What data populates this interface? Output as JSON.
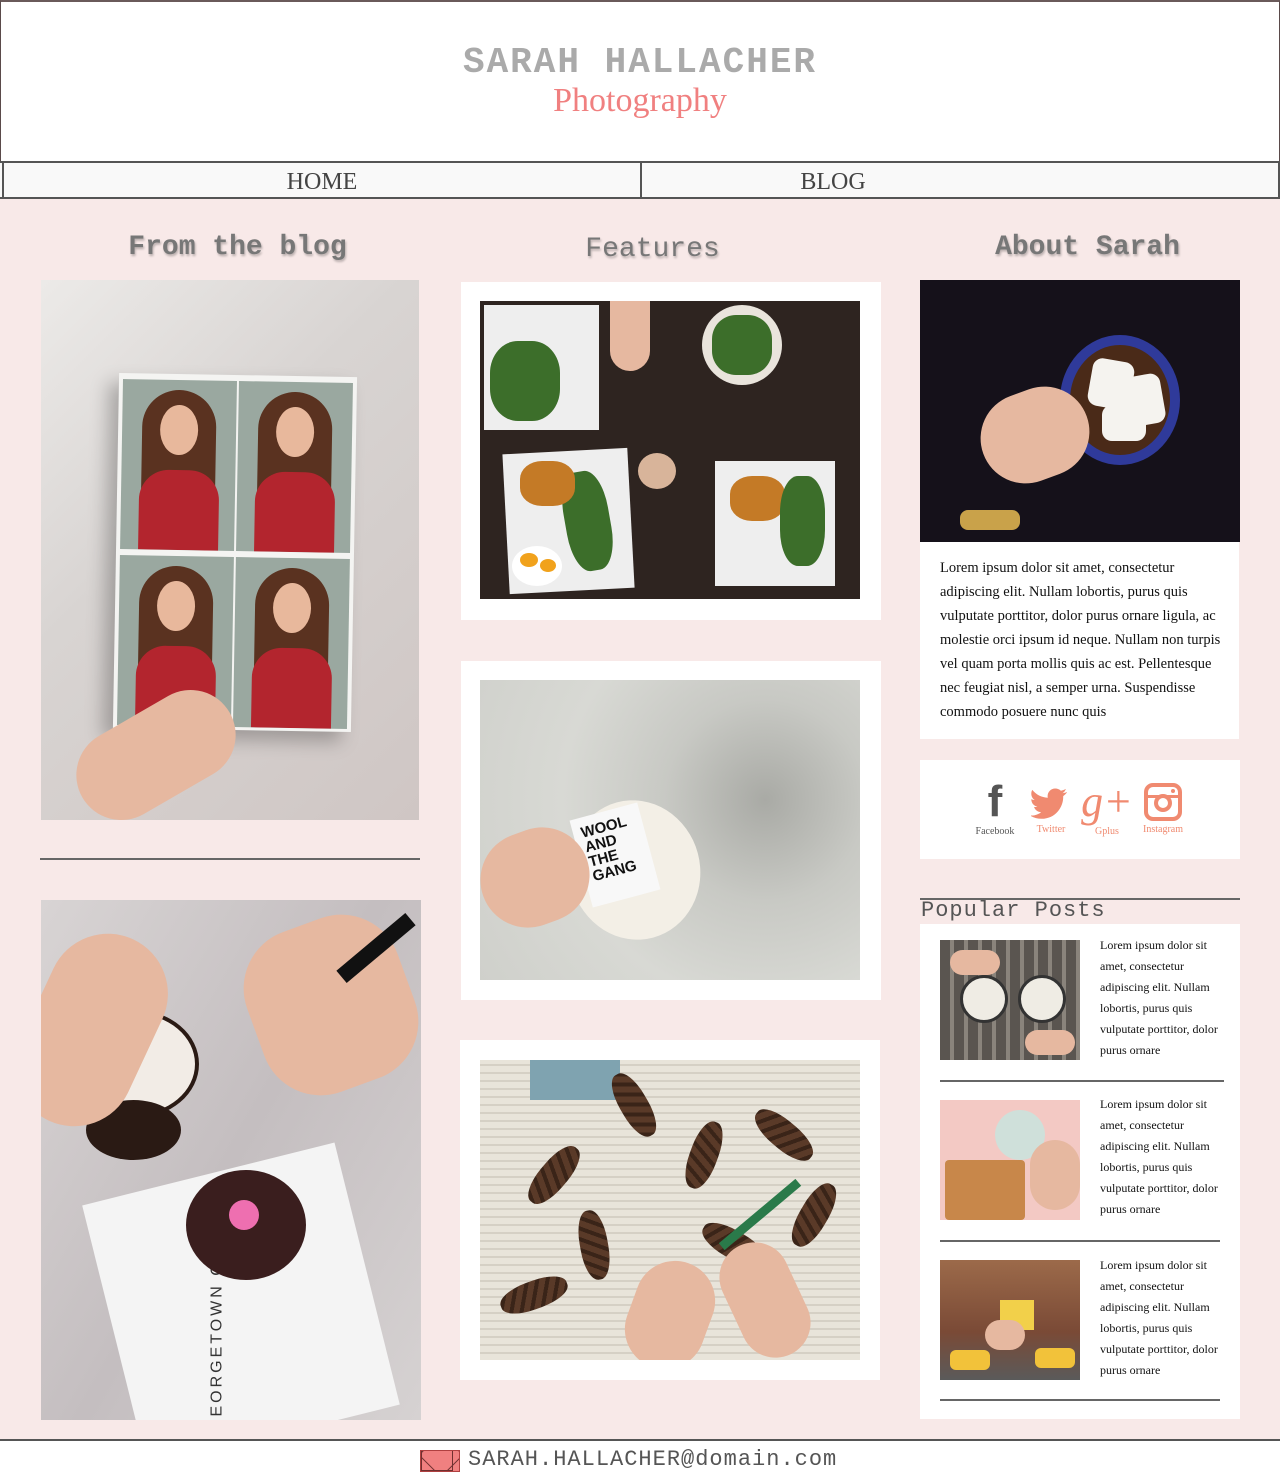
{
  "header": {
    "site_name": "SARAH HALLACHER",
    "tagline": "Photography"
  },
  "nav": {
    "items": [
      {
        "label": "HOME"
      },
      {
        "label": "BLOG"
      }
    ]
  },
  "columns": {
    "blog_title": "From the blog",
    "features_title": "Features",
    "about_title": "About Sarah"
  },
  "features": {
    "yarn_label": "WOOL AND THE GANG"
  },
  "blog": {
    "napkin_text": "GEORGETOWN CUPCAKE"
  },
  "about": {
    "text": "Lorem ipsum dolor sit amet, consectetur adipiscing elit. Nullam lobortis, purus quis vulputate porttitor, dolor purus ornare ligula, ac molestie orci ipsum id neque. Nullam non turpis vel quam porta mollis quis ac est. Pellentesque nec feugiat nisl, a semper urna. Suspendisse commodo posuere nunc quis"
  },
  "social": [
    {
      "label": "Facebook",
      "icon": "facebook-icon",
      "color": "#555555"
    },
    {
      "label": "Twitter",
      "icon": "twitter-icon",
      "color": "#f08a70"
    },
    {
      "label": "Gplus",
      "icon": "gplus-icon",
      "color": "#f08a70"
    },
    {
      "label": "Instagram",
      "icon": "instagram-icon",
      "color": "#f08a70"
    }
  ],
  "popular": {
    "title": "Popular Posts",
    "posts": [
      {
        "text": "Lorem ipsum dolor sit amet, consectetur adipiscing elit. Nullam lobortis, purus quis vulputate porttitor, dolor purus ornare"
      },
      {
        "text": "Lorem ipsum dolor sit amet, consectetur adipiscing elit. Nullam lobortis, purus quis vulputate porttitor, dolor purus ornare"
      },
      {
        "text": "Lorem ipsum dolor sit amet, consectetur adipiscing elit. Nullam lobortis, purus quis vulputate porttitor, dolor purus ornare"
      }
    ]
  },
  "footer": {
    "email": "SARAH.HALLACHER@domain.com",
    "icon": "mail-icon"
  },
  "colors": {
    "accent": "#f08080",
    "background": "#f8e9e8"
  }
}
